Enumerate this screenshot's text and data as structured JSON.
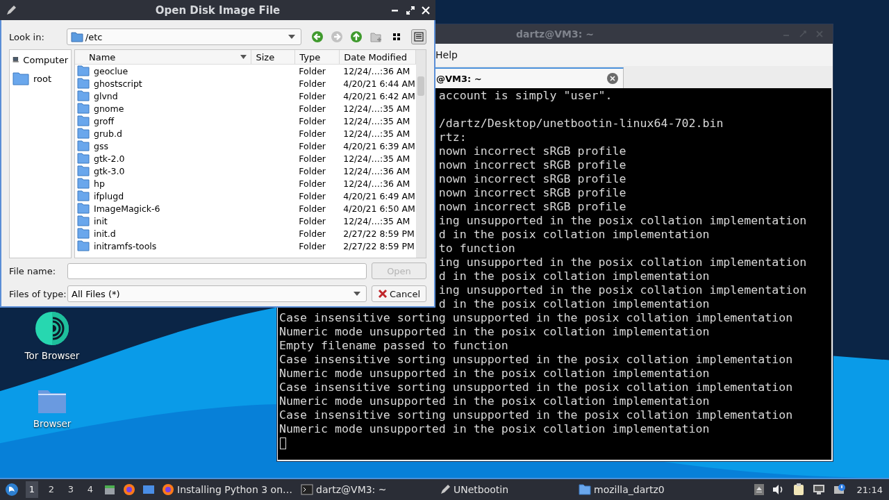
{
  "desktop": {
    "icons": [
      {
        "label": "Tor Browser",
        "kind": "tor"
      },
      {
        "label": "Browser",
        "kind": "folder"
      }
    ]
  },
  "terminal": {
    "title": "dartz@VM3: ~",
    "menu": [
      "Help"
    ],
    "tab": {
      "label": "@VM3: ~"
    },
    "lines": [
      {
        "kind": "tail",
        "text": "account is simply \"user\"."
      },
      {
        "kind": "blank"
      },
      {
        "kind": "tail",
        "text": "/dartz/Desktop/unetbootin-linux64-702.bin"
      },
      {
        "kind": "tail",
        "text": "rtz:"
      },
      {
        "kind": "tail",
        "text": "nown incorrect sRGB profile"
      },
      {
        "kind": "tail",
        "text": "nown incorrect sRGB profile"
      },
      {
        "kind": "tail",
        "text": "nown incorrect sRGB profile"
      },
      {
        "kind": "tail",
        "text": "nown incorrect sRGB profile"
      },
      {
        "kind": "tail",
        "text": "nown incorrect sRGB profile"
      },
      {
        "kind": "tail",
        "text": "ing unsupported in the posix collation implementation"
      },
      {
        "kind": "tail",
        "text": "d in the posix collation implementation"
      },
      {
        "kind": "tail",
        "text": "to function"
      },
      {
        "kind": "tail",
        "text": "ing unsupported in the posix collation implementation"
      },
      {
        "kind": "tail",
        "text": "d in the posix collation implementation"
      },
      {
        "kind": "tail",
        "text": "ing unsupported in the posix collation implementation"
      },
      {
        "kind": "tail",
        "text": "d in the posix collation implementation"
      },
      {
        "kind": "full",
        "text": "Case insensitive sorting unsupported in the posix collation implementation"
      },
      {
        "kind": "full",
        "text": "Numeric mode unsupported in the posix collation implementation"
      },
      {
        "kind": "full",
        "text": "Empty filename passed to function"
      },
      {
        "kind": "full",
        "text": "Case insensitive sorting unsupported in the posix collation implementation"
      },
      {
        "kind": "full",
        "text": "Numeric mode unsupported in the posix collation implementation"
      },
      {
        "kind": "full",
        "text": "Case insensitive sorting unsupported in the posix collation implementation"
      },
      {
        "kind": "full",
        "text": "Numeric mode unsupported in the posix collation implementation"
      },
      {
        "kind": "full",
        "text": "Case insensitive sorting unsupported in the posix collation implementation"
      },
      {
        "kind": "full",
        "text": "Numeric mode unsupported in the posix collation implementation"
      },
      {
        "kind": "cursor"
      }
    ]
  },
  "dialog": {
    "title": "Open Disk Image File",
    "look_in": {
      "label": "Look in:",
      "value": "/etc"
    },
    "view_buttons": [
      {
        "kind": "icons",
        "selected": false
      },
      {
        "kind": "detail",
        "selected": true
      }
    ],
    "places": [
      {
        "label": "Computer",
        "kind": "computer",
        "selected": false
      },
      {
        "label": "root",
        "kind": "folder",
        "selected": false
      }
    ],
    "table": {
      "columns": [
        "Name",
        "Size",
        "Type",
        "Date Modified"
      ],
      "rows": [
        {
          "name": "geoclue",
          "type": "Folder",
          "date": "12/24/…:36 AM"
        },
        {
          "name": "ghostscript",
          "type": "Folder",
          "date": "4/20/21 6:44 AM"
        },
        {
          "name": "glvnd",
          "type": "Folder",
          "date": "4/20/21 6:42 AM"
        },
        {
          "name": "gnome",
          "type": "Folder",
          "date": "12/24/…:35 AM"
        },
        {
          "name": "groff",
          "type": "Folder",
          "date": "12/24/…:35 AM"
        },
        {
          "name": "grub.d",
          "type": "Folder",
          "date": "12/24/…:35 AM"
        },
        {
          "name": "gss",
          "type": "Folder",
          "date": "4/20/21 6:39 AM"
        },
        {
          "name": "gtk-2.0",
          "type": "Folder",
          "date": "12/24/…:35 AM"
        },
        {
          "name": "gtk-3.0",
          "type": "Folder",
          "date": "12/24/…:36 AM"
        },
        {
          "name": "hp",
          "type": "Folder",
          "date": "12/24/…:36 AM"
        },
        {
          "name": "ifplugd",
          "type": "Folder",
          "date": "4/20/21 6:49 AM"
        },
        {
          "name": "ImageMagick-6",
          "type": "Folder",
          "date": "4/20/21 6:50 AM"
        },
        {
          "name": "init",
          "type": "Folder",
          "date": "12/24/…:35 AM"
        },
        {
          "name": "init.d",
          "type": "Folder",
          "date": "2/27/22 8:59 PM"
        },
        {
          "name": "initramfs-tools",
          "type": "Folder",
          "date": "2/27/22 8:59 PM"
        }
      ]
    },
    "file_name": {
      "label": "File name:"
    },
    "open_button": {
      "label": "Open",
      "disabled": true
    },
    "file_type": {
      "label": "Files of type:",
      "value": "All Files (*)"
    },
    "cancel_button": {
      "label": "Cancel"
    }
  },
  "taskbar": {
    "workspaces": [
      {
        "label": "1",
        "selected": true
      },
      {
        "label": "2",
        "selected": false
      },
      {
        "label": "3",
        "selected": false
      },
      {
        "label": "4",
        "selected": false
      }
    ],
    "tasks": [
      {
        "label": "Installing Python 3 on…",
        "kind": "firefox"
      },
      {
        "label": "dartz@VM3: ~",
        "kind": "terminal"
      },
      {
        "label": "UNetbootin",
        "kind": "unetbootin"
      },
      {
        "label": "mozilla_dartz0",
        "kind": "folder"
      }
    ],
    "clock": "21:14"
  }
}
